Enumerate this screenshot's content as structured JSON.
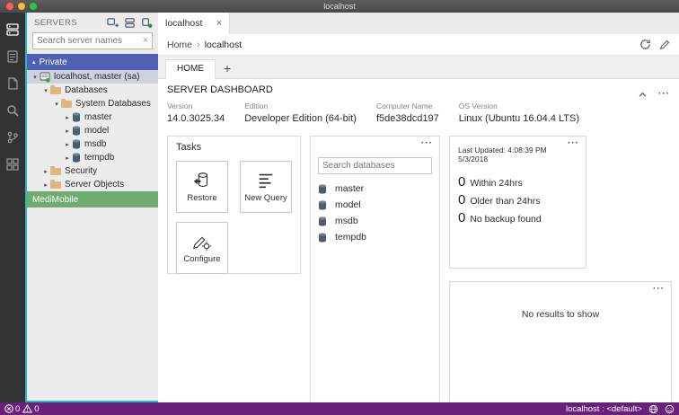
{
  "colors": {
    "statusbar_background": "#68217A",
    "private_group": "#4e5fb4",
    "medimobile_group": "#6fac6f",
    "sidebar_accent_border": "#2bb8c5",
    "folder_icon": "#dcb67a",
    "selected_row": "#ccd2de"
  },
  "icons": {
    "more_glyph": "···",
    "close_glyph": "×",
    "clear_glyph": "×",
    "plus_glyph": "+",
    "breadcrumb_separator": "›",
    "group_expanded_glyph": "▴",
    "tree_expanded_glyph": "▾",
    "tree_collapsed_glyph": "▸"
  },
  "titlebar": {
    "title": "localhost"
  },
  "activity_bar": {
    "items": [
      {
        "name": "servers"
      },
      {
        "name": "task-history"
      },
      {
        "name": "explorer"
      },
      {
        "name": "search"
      },
      {
        "name": "source-control"
      },
      {
        "name": "extensions"
      }
    ]
  },
  "sidebar": {
    "title": "SERVERS",
    "search_placeholder": "Search server names",
    "groups": [
      {
        "label": "Private"
      },
      {
        "label": "MediMobile"
      }
    ],
    "tree": [
      {
        "label": "localhost, master (sa)"
      },
      {
        "label": "Databases"
      },
      {
        "label": "System Databases"
      },
      {
        "label": "master"
      },
      {
        "label": "model"
      },
      {
        "label": "msdb"
      },
      {
        "label": "tempdb"
      },
      {
        "label": "Security"
      },
      {
        "label": "Server Objects"
      }
    ]
  },
  "editor": {
    "tab_label": "localhost",
    "breadcrumb": {
      "root": "Home",
      "current": "localhost"
    },
    "dashboard_tab_label": "HOME",
    "dashboard": {
      "title": "SERVER DASHBOARD",
      "properties": [
        {
          "label": "Version",
          "value": "14.0.3025.34"
        },
        {
          "label": "Edition",
          "value": "Developer Edition (64-bit)"
        },
        {
          "label": "Computer Name",
          "value": "f5de38dcd197"
        },
        {
          "label": "OS Version",
          "value": "Linux (Ubuntu 16.04.4 LTS)"
        }
      ]
    },
    "widgets": {
      "tasks": {
        "title": "Tasks",
        "buttons": [
          {
            "label": "Restore"
          },
          {
            "label": "New Query"
          },
          {
            "label": "Configure"
          }
        ]
      },
      "databases": {
        "search_placeholder": "Search databases",
        "items": [
          {
            "name": "master"
          },
          {
            "name": "model"
          },
          {
            "name": "msdb"
          },
          {
            "name": "tempdb"
          }
        ]
      },
      "backup": {
        "last_updated": "Last Updated: 4:08:39 PM 5/3/2018",
        "items": [
          {
            "count": "0",
            "label": "Within 24hrs"
          },
          {
            "count": "0",
            "label": "Older than 24hrs"
          },
          {
            "count": "0",
            "label": "No backup found"
          }
        ]
      },
      "results": {
        "empty_message": "No results to show"
      }
    }
  },
  "statusbar": {
    "error_count": "0",
    "warning_count": "0",
    "connection": "localhost : <default>"
  }
}
